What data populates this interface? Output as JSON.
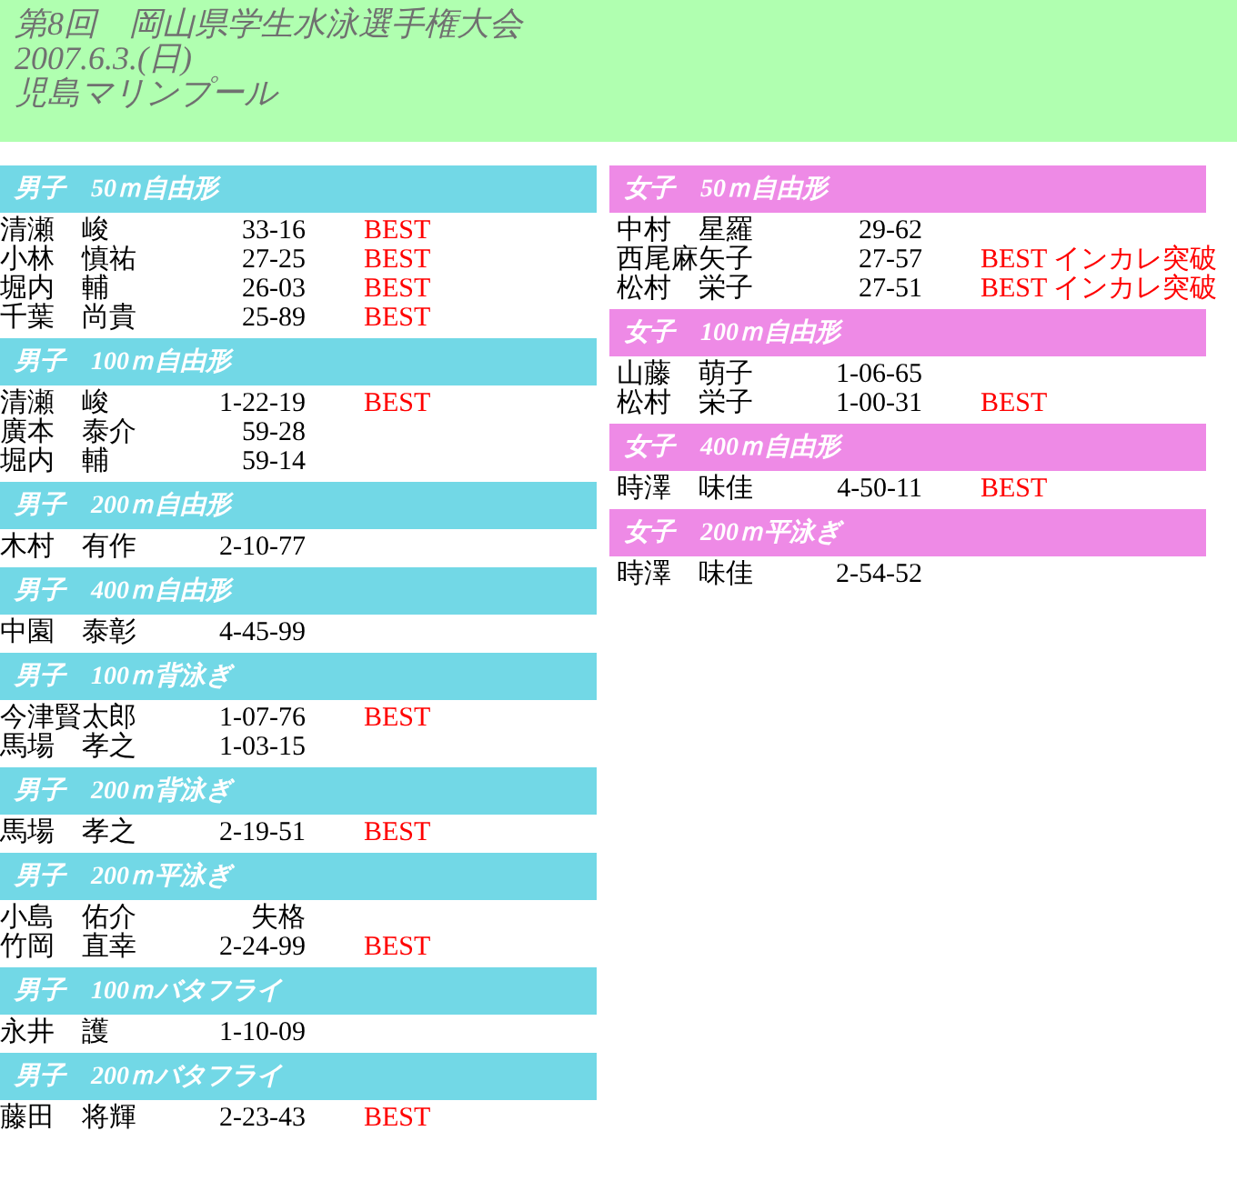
{
  "header": {
    "lines": [
      "第8回　岡山県学生水泳選手権大会",
      "2007.6.3.(日)",
      "児島マリンプール"
    ]
  },
  "columns": [
    {
      "kind": "men",
      "sections": [
        {
          "title": "男子　50ｍ自由形",
          "rows": [
            {
              "name": "清瀬　峻",
              "time": "33-16",
              "note": "BEST"
            },
            {
              "name": "小林　慎祐",
              "time": "27-25",
              "note": "BEST"
            },
            {
              "name": "堀内　輔",
              "time": "26-03",
              "note": "BEST"
            },
            {
              "name": "千葉　尚貴",
              "time": "25-89",
              "note": "BEST"
            }
          ]
        },
        {
          "title": "男子　100ｍ自由形",
          "rows": [
            {
              "name": "清瀬　峻",
              "time": "1-22-19",
              "note": "BEST"
            },
            {
              "name": "廣本　泰介",
              "time": "59-28"
            },
            {
              "name": "堀内　輔",
              "time": "59-14"
            }
          ]
        },
        {
          "title": "男子　200ｍ自由形",
          "rows": [
            {
              "name": "木村　有作",
              "time": "2-10-77"
            }
          ]
        },
        {
          "title": "男子　400ｍ自由形",
          "rows": [
            {
              "name": "中園　泰彰",
              "time": "4-45-99"
            }
          ]
        },
        {
          "title": "男子　100ｍ背泳ぎ",
          "rows": [
            {
              "name": "今津賢太郎",
              "time": "1-07-76",
              "note": "BEST"
            },
            {
              "name": "馬場　孝之",
              "time": "1-03-15"
            }
          ]
        },
        {
          "title": "男子　200ｍ背泳ぎ",
          "rows": [
            {
              "name": "馬場　孝之",
              "time": "2-19-51",
              "note": "BEST"
            }
          ]
        },
        {
          "title": "男子　200ｍ平泳ぎ",
          "rows": [
            {
              "name": "小島　佑介",
              "time": "失格"
            },
            {
              "name": "竹岡　直幸",
              "time": "2-24-99",
              "note": "BEST"
            }
          ]
        },
        {
          "title": "男子　100ｍバタフライ",
          "rows": [
            {
              "name": "永井　護",
              "time": "1-10-09"
            }
          ]
        },
        {
          "title": "男子　200ｍバタフライ",
          "rows": [
            {
              "name": "藤田　将輝",
              "time": "2-23-43",
              "note": "BEST"
            }
          ]
        }
      ]
    },
    {
      "kind": "women",
      "sections": [
        {
          "title": "女子　50ｍ自由形",
          "rows": [
            {
              "name": "中村　星羅",
              "time": "29-62"
            },
            {
              "name": "西尾麻矢子",
              "time": "27-57",
              "note": "BEST インカレ突破"
            },
            {
              "name": "松村　栄子",
              "time": "27-51",
              "note": "BEST インカレ突破"
            }
          ]
        },
        {
          "title": "女子　100ｍ自由形",
          "rows": [
            {
              "name": "山藤　萌子",
              "time": "1-06-65"
            },
            {
              "name": "松村　栄子",
              "time": "1-00-31",
              "note": "BEST"
            }
          ]
        },
        {
          "title": "女子　400ｍ自由形",
          "rows": [
            {
              "name": "時澤　味佳",
              "time": "4-50-11",
              "note": "BEST"
            }
          ]
        },
        {
          "title": "女子　200ｍ平泳ぎ",
          "rows": [
            {
              "name": "時澤　味佳",
              "time": "2-54-52"
            }
          ]
        }
      ]
    }
  ]
}
